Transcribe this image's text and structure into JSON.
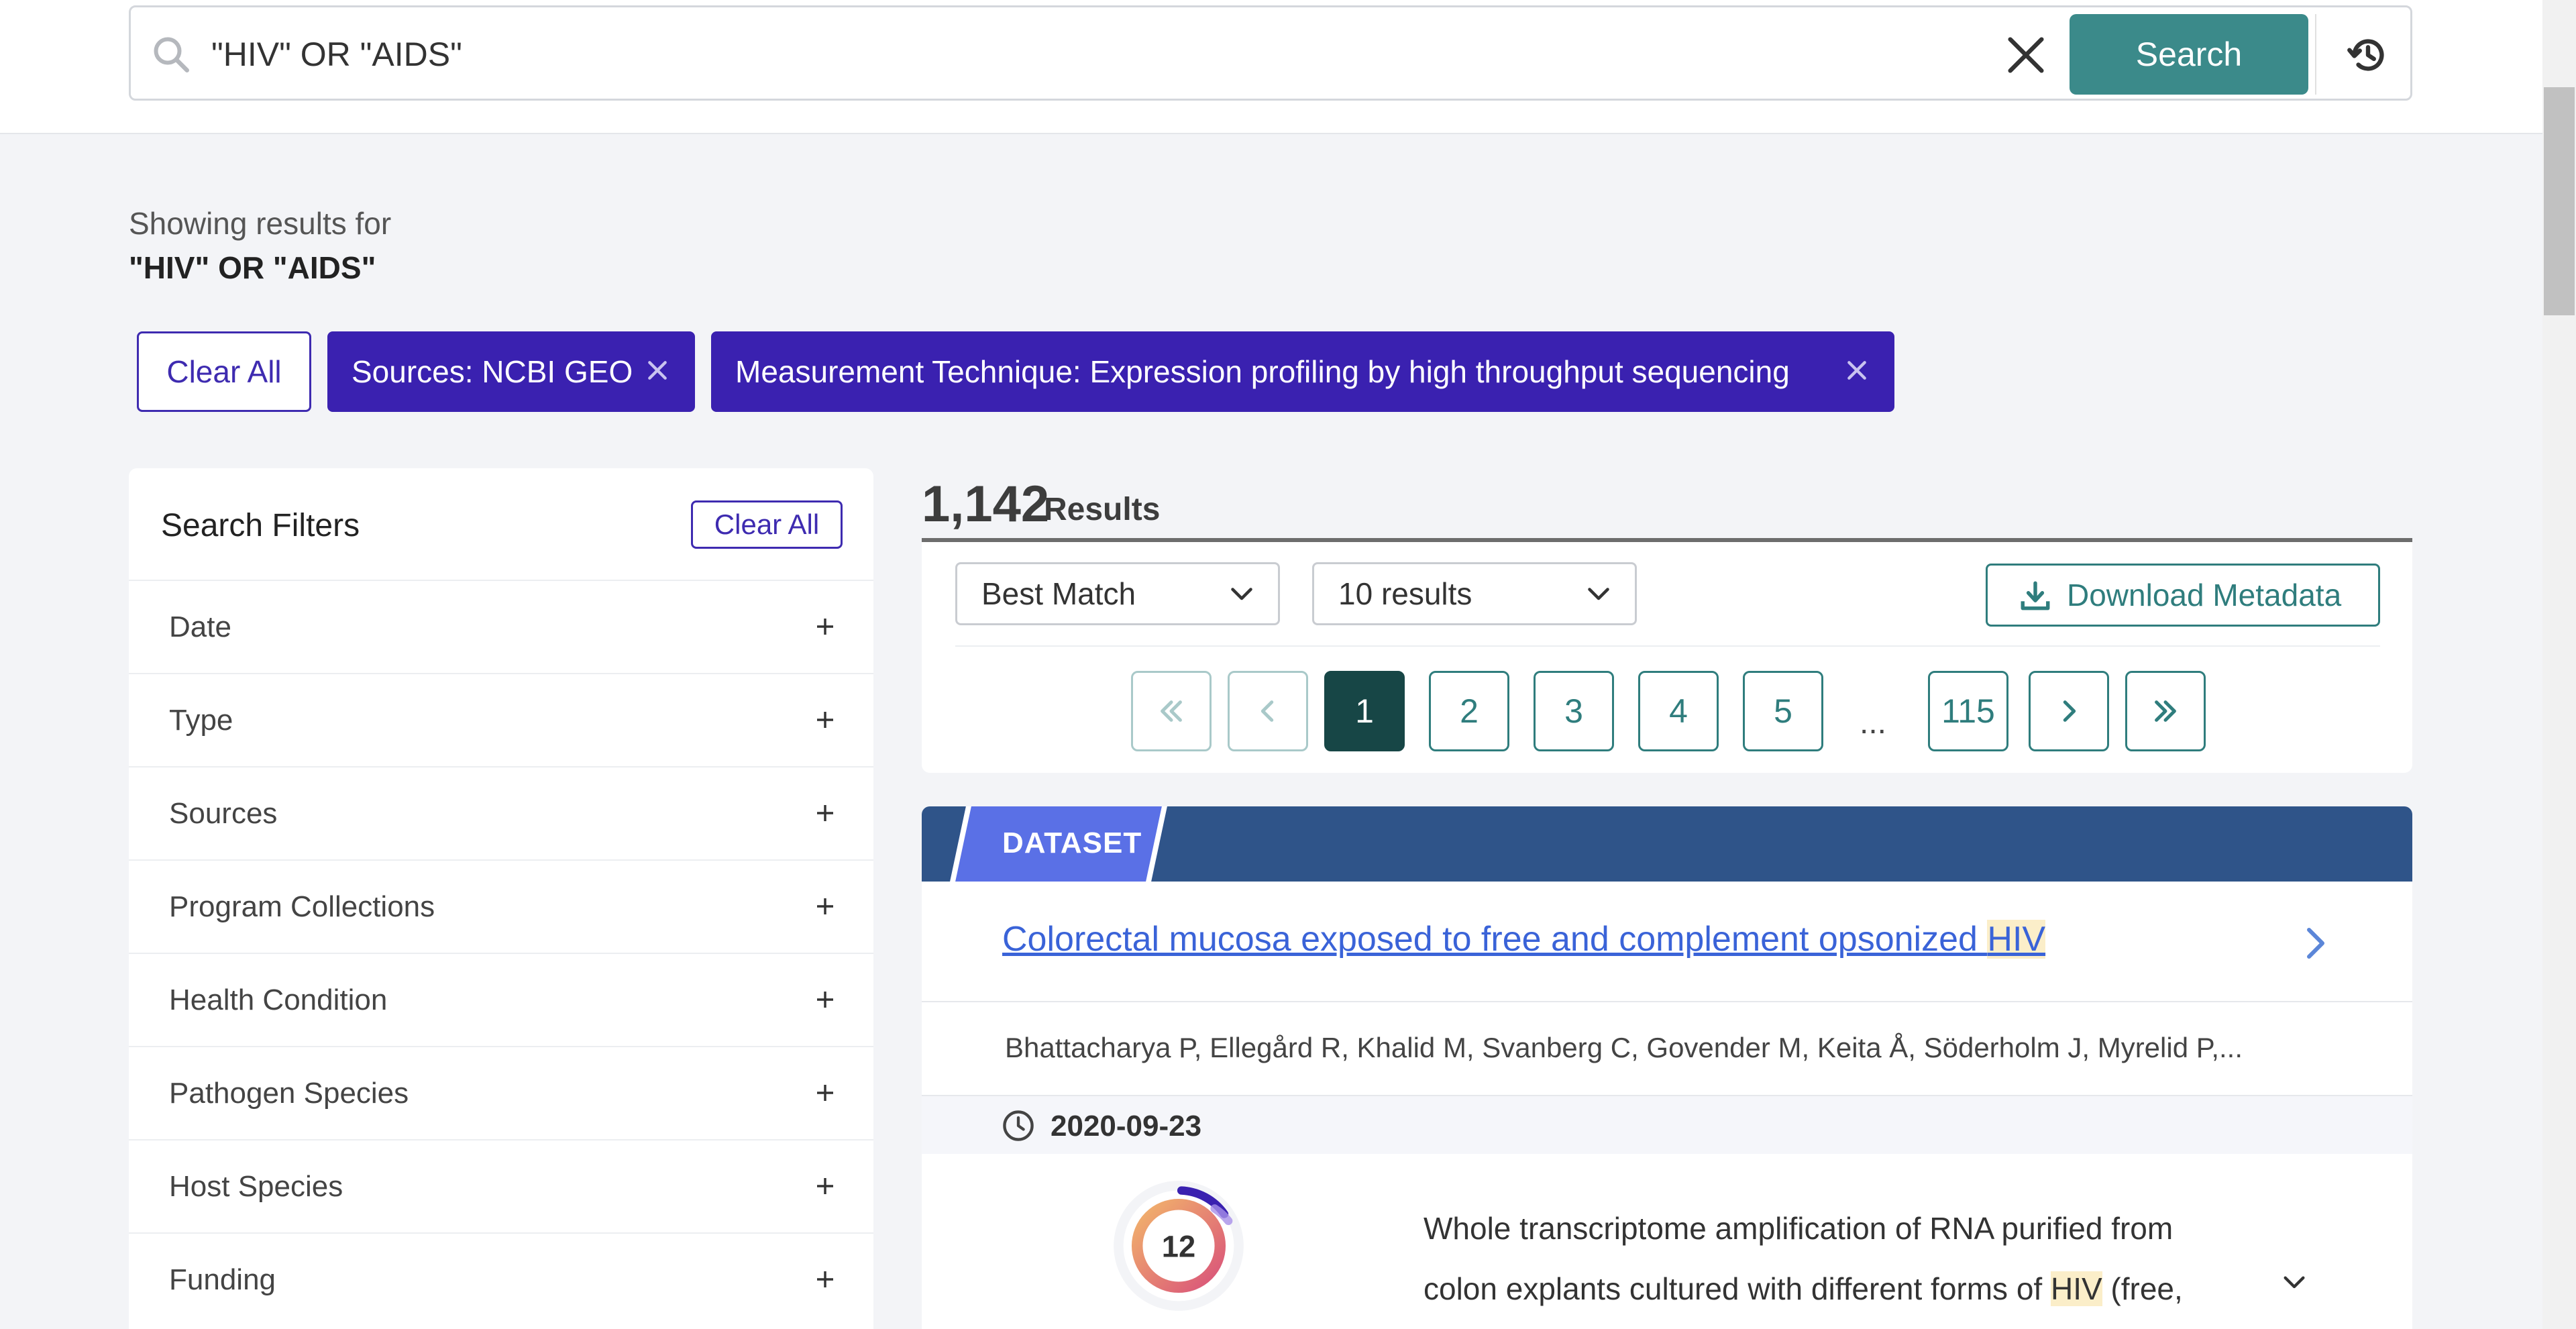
{
  "header": {
    "search_value": "\"HIV\" OR \"AIDS\"",
    "search_button": "Search"
  },
  "showing": {
    "label": "Showing results for",
    "query": "\"HIV\" OR \"AIDS\""
  },
  "chips": {
    "clear_all": "Clear All",
    "items": [
      {
        "label": "Sources: NCBI GEO"
      },
      {
        "label": "Measurement Technique: Expression profiling by high throughput sequencing"
      }
    ]
  },
  "filters": {
    "title": "Search Filters",
    "clear_all": "Clear All",
    "items": [
      {
        "label": "Date"
      },
      {
        "label": "Type"
      },
      {
        "label": "Sources"
      },
      {
        "label": "Program Collections"
      },
      {
        "label": "Health Condition"
      },
      {
        "label": "Pathogen Species"
      },
      {
        "label": "Host Species"
      },
      {
        "label": "Funding"
      }
    ]
  },
  "results": {
    "count": "1,142",
    "word": "Results",
    "sort_selected": "Best Match",
    "size_selected": "10 results",
    "download_label": "Download Metadata"
  },
  "pagination": {
    "pages": [
      "1",
      "2",
      "3",
      "4",
      "5"
    ],
    "ellipsis": "...",
    "last_page": "115",
    "current": "1"
  },
  "card": {
    "type": "DATASET",
    "title_prefix": "Colorectal mucosa exposed to free and complement opsonized ",
    "title_highlight": "HIV",
    "authors": "Bhattacharya P, Ellegård R, Khalid M, Svanberg C, Govender M, Keita Å, Söderholm J, Myrelid P,...",
    "date": "2020-09-23",
    "score": "12",
    "desc_line1": "Whole transcriptome amplification of RNA purified from",
    "desc_line2_prefix": "colon explants cultured with different forms of ",
    "desc_highlight": "HIV",
    "desc_line2_suffix": " (free,"
  },
  "colors": {
    "primary_teal": "#3b8a8a",
    "chip_indigo": "#3a21b0",
    "card_band": "#2f5489",
    "tag_blue": "#5a70e6",
    "link_blue": "#3a63d8",
    "highlight": "#fbeec9"
  },
  "icons": {
    "search": "search-icon",
    "clear": "close-icon",
    "history": "history-icon",
    "download": "download-icon",
    "clock": "clock-icon"
  }
}
